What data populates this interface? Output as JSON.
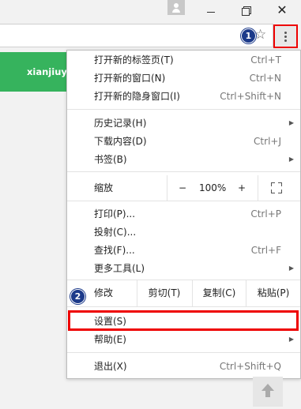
{
  "titlebar": {
    "minimize_icon": "minimize-icon",
    "restore_icon": "restore-icon",
    "close_glyph": "✕"
  },
  "toolbar": {
    "bookmark_star_glyph": "☆",
    "badge_1": "1",
    "badge_2": "2"
  },
  "page": {
    "green_bar_text": "xianjiuye"
  },
  "menu": {
    "group1": [
      {
        "label": "打开新的标签页(T)",
        "shortcut": "Ctrl+T"
      },
      {
        "label": "打开新的窗口(N)",
        "shortcut": "Ctrl+N"
      },
      {
        "label": "打开新的隐身窗口(I)",
        "shortcut": "Ctrl+Shift+N"
      }
    ],
    "group2": [
      {
        "label": "历史记录(H)",
        "shortcut": ""
      },
      {
        "label": "下载内容(D)",
        "shortcut": "Ctrl+J"
      },
      {
        "label": "书签(B)",
        "shortcut": ""
      }
    ],
    "zoom": {
      "label": "缩放",
      "minus": "−",
      "value": "100%",
      "plus": "+"
    },
    "group3": [
      {
        "label": "打印(P)...",
        "shortcut": "Ctrl+P"
      },
      {
        "label": "投射(C)...",
        "shortcut": ""
      },
      {
        "label": "查找(F)...",
        "shortcut": "Ctrl+F"
      },
      {
        "label": "更多工具(L)",
        "shortcut": ""
      }
    ],
    "edit": {
      "label": "修改",
      "cut": "剪切(T)",
      "copy": "复制(C)",
      "paste": "粘贴(P)"
    },
    "group4": [
      {
        "label": "设置(S)",
        "shortcut": ""
      },
      {
        "label": "帮助(E)",
        "shortcut": ""
      }
    ],
    "group5": [
      {
        "label": "退出(X)",
        "shortcut": "Ctrl+Shift+Q"
      }
    ],
    "submenu_arrow": "▶"
  },
  "colors": {
    "highlight_red": "#e00000",
    "badge_blue": "#1c3a8a",
    "green": "#36b35d"
  }
}
